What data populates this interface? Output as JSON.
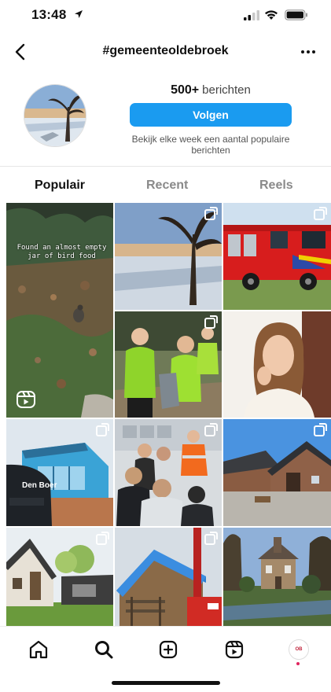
{
  "status_bar": {
    "time": "13:48"
  },
  "header": {
    "title": "#gemeenteoldebroek"
  },
  "profile": {
    "post_count": "500+",
    "post_label": "berichten",
    "follow_label": "Volgen",
    "description": "Bekijk elke week een aantal populaire berichten"
  },
  "tabs": [
    {
      "label": "Populair",
      "active": true
    },
    {
      "label": "Recent",
      "active": false
    },
    {
      "label": "Reels",
      "active": false
    }
  ],
  "posts": [
    {
      "caption": "Found an almost empty jar of bird food",
      "type": "reel"
    },
    {
      "type": "multi"
    },
    {
      "type": "multi"
    },
    {
      "type": "multi"
    },
    {
      "type": "single"
    },
    {
      "type": "multi",
      "sign": "Den Boer"
    },
    {
      "type": "multi"
    },
    {
      "type": "multi"
    },
    {
      "type": "multi"
    },
    {
      "type": "single"
    },
    {
      "type": "single"
    }
  ],
  "bottom_nav": {
    "profile_badge": "OB"
  },
  "colors": {
    "accent": "#1a9bf0",
    "notification": "#e0245e"
  }
}
